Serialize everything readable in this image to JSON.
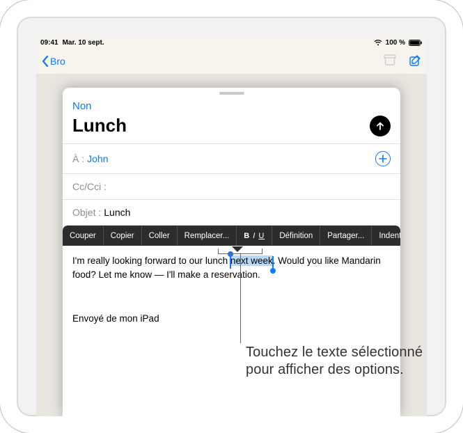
{
  "status": {
    "time": "09:41",
    "date": "Mar. 10 sept.",
    "battery_pct": "100 %"
  },
  "background": {
    "back_label": "Bro"
  },
  "compose": {
    "cancel": "Non",
    "title": "Lunch",
    "to_label": "À :",
    "to_value": "John",
    "cc_label": "Cc/Cci :",
    "subject_label": "Objet :",
    "subject_value": "Lunch",
    "body_before": "I'm really looking forward to our lunch ",
    "body_selected": "next week",
    "body_after": ". Would you like Mandarin food? Let me know — I'll make a reservation.",
    "signature": "Envoyé de mon iPad"
  },
  "toolbar": {
    "cut": "Couper",
    "copy": "Copier",
    "paste": "Coller",
    "replace": "Remplacer...",
    "biu_b": "B",
    "biu_i": "I",
    "biu_u": "U",
    "define": "Définition",
    "share": "Partager...",
    "indent": "Indentation"
  },
  "callout": {
    "text": "Touchez le texte sélectionné pour afficher des options."
  }
}
